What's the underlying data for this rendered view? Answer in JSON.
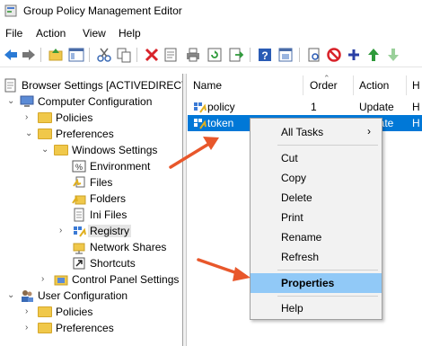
{
  "window": {
    "title": "Group Policy Management Editor"
  },
  "menubar": {
    "items": [
      "File",
      "Action",
      "View",
      "Help"
    ]
  },
  "toolbar": {
    "icons": [
      "back-icon",
      "forward-icon",
      "up-folder-icon",
      "show-tree-icon",
      "cut-icon",
      "copy-icon",
      "delete-icon",
      "properties-icon",
      "print-icon",
      "refresh-icon",
      "export-icon",
      "help-icon",
      "console-icon",
      "preview-icon",
      "disable-icon",
      "add-icon",
      "move-up-icon",
      "move-down-icon"
    ]
  },
  "tree": {
    "items": [
      {
        "label": "Browser Settings [ACTIVEDIRECTO"
      },
      {
        "label": "Computer Configuration"
      },
      {
        "label": "Policies"
      },
      {
        "label": "Preferences"
      },
      {
        "label": "Windows Settings"
      },
      {
        "label": "Environment"
      },
      {
        "label": "Files"
      },
      {
        "label": "Folders"
      },
      {
        "label": "Ini Files"
      },
      {
        "label": "Registry"
      },
      {
        "label": "Network Shares"
      },
      {
        "label": "Shortcuts"
      },
      {
        "label": "Control Panel Settings"
      },
      {
        "label": "User Configuration"
      },
      {
        "label": "Policies"
      },
      {
        "label": "Preferences"
      }
    ]
  },
  "list": {
    "columns": [
      "Name",
      "Order",
      "Action",
      "H"
    ],
    "rows": [
      {
        "name": "policy",
        "order": "1",
        "action": "Update",
        "h": "H"
      },
      {
        "name": "token",
        "order": "",
        "action": "date",
        "h": "H"
      }
    ]
  },
  "context_menu": {
    "items": [
      {
        "label": "All Tasks",
        "submenu": "›"
      },
      {
        "label": "Cut"
      },
      {
        "label": "Copy"
      },
      {
        "label": "Delete"
      },
      {
        "label": "Print"
      },
      {
        "label": "Rename"
      },
      {
        "label": "Refresh"
      },
      {
        "label": "Properties"
      },
      {
        "label": "Help"
      }
    ]
  },
  "colors": {
    "selection": "#0078d7",
    "menu_highlight": "#91c9f7",
    "annotation_arrow": "#e8572b",
    "folder": "#f0c84a"
  }
}
